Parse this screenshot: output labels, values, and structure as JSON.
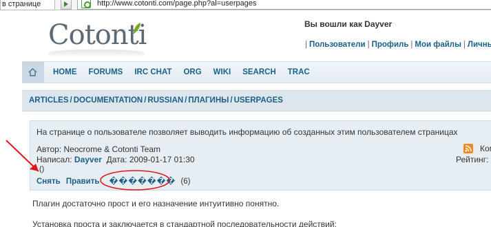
{
  "browser": {
    "tab_title": "в странице",
    "url": "http://www.cotonti.com/page.php?al=userpages"
  },
  "header": {
    "logo_text": "Cotonti",
    "welcome": "Вы вошли как Dayver",
    "user_menu": [
      "Пользователи",
      "Профиль",
      "Мои файлы",
      "Личные"
    ]
  },
  "nav": {
    "items": [
      "HOME",
      "FORUMS",
      "IRC CHAT",
      "ORG",
      "WIKI",
      "SEARCH",
      "TRAC"
    ]
  },
  "breadcrumb": [
    "ARTICLES",
    "DOCUMENTATION",
    "RUSSIAN",
    "ПЛАГИНЫ",
    "USERPAGES"
  ],
  "page_info": {
    "description": "На странице о пользователе позволяет выводить информацию об созданных этим пользователем страницах",
    "author_label": "Автор:",
    "author": "Neocrome & Cotonti Team",
    "posted_label": "Написал:",
    "posted_by": "Dayver",
    "date_label": "Дата:",
    "date": "2009-01-17 01:30",
    "paren": "()",
    "actions": [
      "Снять",
      "Править"
    ],
    "broken_label": "�������",
    "broken_count": "(6)",
    "rss_label": "Ком",
    "rating_label": "Рейтинг:"
  },
  "body": {
    "paragraph_1": "Плагин достаточно прост и его назначение интуитивно понятно.",
    "paragraph_2": "Установка проста и заключается в стандартной последовательности действий:"
  },
  "colors": {
    "link": "#1b5f87",
    "annotation_red": "#e0161b",
    "rss_orange": "#f08a24",
    "logo_gray": "#5d6a75"
  }
}
